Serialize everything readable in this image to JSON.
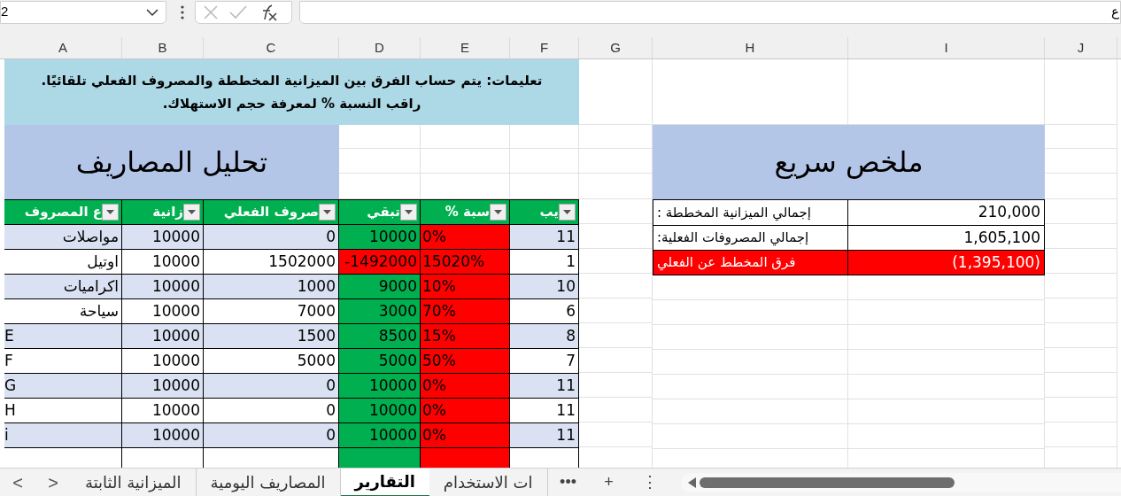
{
  "formula_bar": {
    "name_box": "2",
    "edge_text": "ع"
  },
  "columns": [
    "J",
    "I",
    "H",
    "G",
    "F",
    "E",
    "D",
    "C",
    "B",
    "A"
  ],
  "instructions": "تعليمات: يتم حساب الفرق بين الميزانية المخططة والمصروف الفعلي تلقائيًا. راقب النسبة % لمعرفة حجم الاستهلاك.",
  "expense_table": {
    "title": "تحليل المصاريف",
    "headers": [
      "يب",
      "سبة %",
      "تبقي",
      "صروف الفعلي",
      "زانية",
      "ع المصروف"
    ],
    "rows": [
      {
        "name": "مواصلات",
        "budget": "10000",
        "actual": "0",
        "remaining": "10000",
        "percent": "0%",
        "rank": "11",
        "over_budget": false
      },
      {
        "name": "اوتيل",
        "budget": "10000",
        "actual": "1502000",
        "remaining": "-1492000",
        "percent": "15020%",
        "rank": "1",
        "over_budget": true
      },
      {
        "name": "اكراميات",
        "budget": "10000",
        "actual": "1000",
        "remaining": "9000",
        "percent": "10%",
        "rank": "10",
        "over_budget": false
      },
      {
        "name": "سياحة",
        "budget": "10000",
        "actual": "7000",
        "remaining": "3000",
        "percent": "70%",
        "rank": "6",
        "over_budget": false
      },
      {
        "name": "E",
        "budget": "10000",
        "actual": "1500",
        "remaining": "8500",
        "percent": "15%",
        "rank": "8",
        "over_budget": false
      },
      {
        "name": "F",
        "budget": "10000",
        "actual": "5000",
        "remaining": "5000",
        "percent": "50%",
        "rank": "7",
        "over_budget": false
      },
      {
        "name": "G",
        "budget": "10000",
        "actual": "0",
        "remaining": "10000",
        "percent": "0%",
        "rank": "11",
        "over_budget": false
      },
      {
        "name": "H",
        "budget": "10000",
        "actual": "0",
        "remaining": "10000",
        "percent": "0%",
        "rank": "11",
        "over_budget": false
      },
      {
        "name": "i",
        "budget": "10000",
        "actual": "0",
        "remaining": "10000",
        "percent": "0%",
        "rank": "11",
        "over_budget": false
      },
      {
        "over_budget": false
      }
    ]
  },
  "summary": {
    "title": "ملخص سريع",
    "rows": [
      {
        "label": "إجمالي الميزانية المخططة :",
        "value": "210,000",
        "highlight": false
      },
      {
        "label": "إجمالي المصروفات الفعلية:",
        "value": "1,605,100",
        "highlight": false
      },
      {
        "label": "فرق المخطط عن الفعلي",
        "value": "(1,395,100)",
        "highlight": true
      }
    ]
  },
  "sheet_nav": [
    ">",
    "<"
  ],
  "sheet_tabs": [
    {
      "label": "ات الاستخدام",
      "selected": false
    },
    {
      "label": "التقارير",
      "selected": true
    },
    {
      "label": "المصاريف اليومية",
      "selected": false
    },
    {
      "label": "الميزانية الثابتة",
      "selected": false
    }
  ],
  "tab_actions": [
    "⋮",
    "+",
    "•••"
  ]
}
